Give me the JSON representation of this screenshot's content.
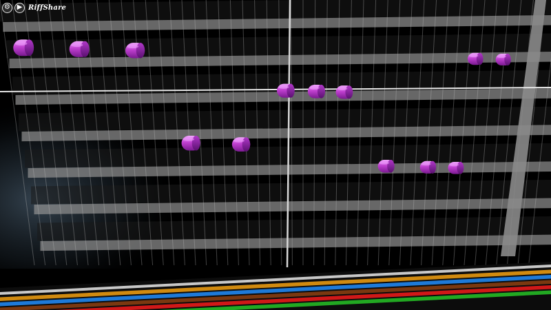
{
  "app": {
    "title": "RiffShare"
  },
  "toolbar": {
    "settings_icon": "gear-icon",
    "play_icon": "play-icon"
  },
  "piano_roll": {
    "lane_count": 14,
    "note_color": "#c040d0",
    "note_highlight": "#f0a0ff",
    "notes": [
      {
        "beat": 0.3,
        "lane": 2
      },
      {
        "beat": 2.3,
        "lane": 2
      },
      {
        "beat": 4.3,
        "lane": 2
      },
      {
        "beat": 16.5,
        "lane": 2
      },
      {
        "beat": 17.5,
        "lane": 2
      },
      {
        "beat": 9.7,
        "lane": 4
      },
      {
        "beat": 10.8,
        "lane": 4
      },
      {
        "beat": 11.8,
        "lane": 4
      },
      {
        "beat": 6.3,
        "lane": 7
      },
      {
        "beat": 8.1,
        "lane": 7
      },
      {
        "beat": 13.3,
        "lane": 8
      },
      {
        "beat": 14.8,
        "lane": 8
      },
      {
        "beat": 15.8,
        "lane": 8
      }
    ],
    "track_strip_colors": [
      "#c8c8c8",
      "#d08a10",
      "#1e7ad8",
      "#7a3810",
      "#d01818",
      "#22a822"
    ]
  }
}
